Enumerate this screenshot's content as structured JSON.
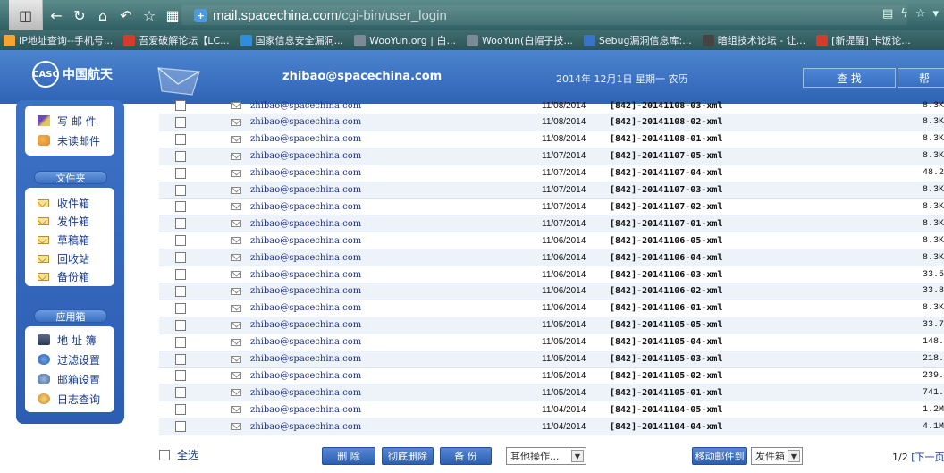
{
  "browser": {
    "url_host": "mail.spacechina.com",
    "url_path": "/cgi-bin/user_login",
    "bookmarks": [
      {
        "label": "IP地址查询--手机号...",
        "color": "#f3a530"
      },
      {
        "label": "吾爱破解论坛【LC...",
        "color": "#d23b2e"
      },
      {
        "label": "国家信息安全漏洞...",
        "color": "#2f8de0"
      },
      {
        "label": "WooYun.org | 白...",
        "color": "#7a8a96"
      },
      {
        "label": "WooYun(白帽子技...",
        "color": "#7a8a96"
      },
      {
        "label": "Sebug漏洞信息库:...",
        "color": "#3a74c8"
      },
      {
        "label": "暗组技术论坛 - 让...",
        "color": "#444"
      },
      {
        "label": "[新提醒] 卡饭论...",
        "color": "#d23b2e"
      }
    ]
  },
  "header": {
    "logo_text": "中国航天",
    "account": "zhibao@spacechina.com",
    "date": "2014年 12月1日 星期一 农历",
    "search_button": "查 找",
    "help_button": "帮"
  },
  "sidebar": {
    "top_items": [
      {
        "label": "写 邮 件",
        "icon": "pen-icon"
      },
      {
        "label": "未读邮件",
        "icon": "unread-mail-icon"
      }
    ],
    "folders_title": "文件夹",
    "folders": [
      {
        "label": "收件箱"
      },
      {
        "label": "发件箱"
      },
      {
        "label": "草稿箱"
      },
      {
        "label": "回收站"
      },
      {
        "label": "备份箱"
      }
    ],
    "apps_title": "应用箱",
    "apps": [
      {
        "label": "地 址 簿",
        "icon": "address-book-icon"
      },
      {
        "label": "过滤设置",
        "icon": "filter-icon"
      },
      {
        "label": "邮箱设置",
        "icon": "settings-icon"
      },
      {
        "label": "日志查询",
        "icon": "log-search-icon"
      }
    ]
  },
  "mail_list": [
    {
      "from": "zhibao@spacechina.com",
      "date": "11/08/2014",
      "subject": "[842]-20141108-03-xml",
      "size": "8.3K"
    },
    {
      "from": "zhibao@spacechina.com",
      "date": "11/08/2014",
      "subject": "[842]-20141108-02-xml",
      "size": "8.3K"
    },
    {
      "from": "zhibao@spacechina.com",
      "date": "11/08/2014",
      "subject": "[842]-20141108-01-xml",
      "size": "8.3K"
    },
    {
      "from": "zhibao@spacechina.com",
      "date": "11/07/2014",
      "subject": "[842]-20141107-05-xml",
      "size": "8.3K"
    },
    {
      "from": "zhibao@spacechina.com",
      "date": "11/07/2014",
      "subject": "[842]-20141107-04-xml",
      "size": "48.2"
    },
    {
      "from": "zhibao@spacechina.com",
      "date": "11/07/2014",
      "subject": "[842]-20141107-03-xml",
      "size": "8.3K"
    },
    {
      "from": "zhibao@spacechina.com",
      "date": "11/07/2014",
      "subject": "[842]-20141107-02-xml",
      "size": "8.3K"
    },
    {
      "from": "zhibao@spacechina.com",
      "date": "11/07/2014",
      "subject": "[842]-20141107-01-xml",
      "size": "8.3K"
    },
    {
      "from": "zhibao@spacechina.com",
      "date": "11/06/2014",
      "subject": "[842]-20141106-05-xml",
      "size": "8.3K"
    },
    {
      "from": "zhibao@spacechina.com",
      "date": "11/06/2014",
      "subject": "[842]-20141106-04-xml",
      "size": "8.3K"
    },
    {
      "from": "zhibao@spacechina.com",
      "date": "11/06/2014",
      "subject": "[842]-20141106-03-xml",
      "size": "33.5"
    },
    {
      "from": "zhibao@spacechina.com",
      "date": "11/06/2014",
      "subject": "[842]-20141106-02-xml",
      "size": "33.8"
    },
    {
      "from": "zhibao@spacechina.com",
      "date": "11/06/2014",
      "subject": "[842]-20141106-01-xml",
      "size": "8.3K"
    },
    {
      "from": "zhibao@spacechina.com",
      "date": "11/05/2014",
      "subject": "[842]-20141105-05-xml",
      "size": "33.7"
    },
    {
      "from": "zhibao@spacechina.com",
      "date": "11/05/2014",
      "subject": "[842]-20141105-04-xml",
      "size": "148."
    },
    {
      "from": "zhibao@spacechina.com",
      "date": "11/05/2014",
      "subject": "[842]-20141105-03-xml",
      "size": "218."
    },
    {
      "from": "zhibao@spacechina.com",
      "date": "11/05/2014",
      "subject": "[842]-20141105-02-xml",
      "size": "239."
    },
    {
      "from": "zhibao@spacechina.com",
      "date": "11/05/2014",
      "subject": "[842]-20141105-01-xml",
      "size": "741."
    },
    {
      "from": "zhibao@spacechina.com",
      "date": "11/04/2014",
      "subject": "[842]-20141104-05-xml",
      "size": "1.2M"
    },
    {
      "from": "zhibao@spacechina.com",
      "date": "11/04/2014",
      "subject": "[842]-20141104-04-xml",
      "size": "4.1M"
    }
  ],
  "bottom": {
    "select_all": "全选",
    "delete": "删 除",
    "purge": "彻底删除",
    "backup": "备 份",
    "other_ops": "其他操作...",
    "move_to": "移动邮件到",
    "move_target": "发件箱",
    "page": "1/2",
    "next": "[下一页"
  }
}
